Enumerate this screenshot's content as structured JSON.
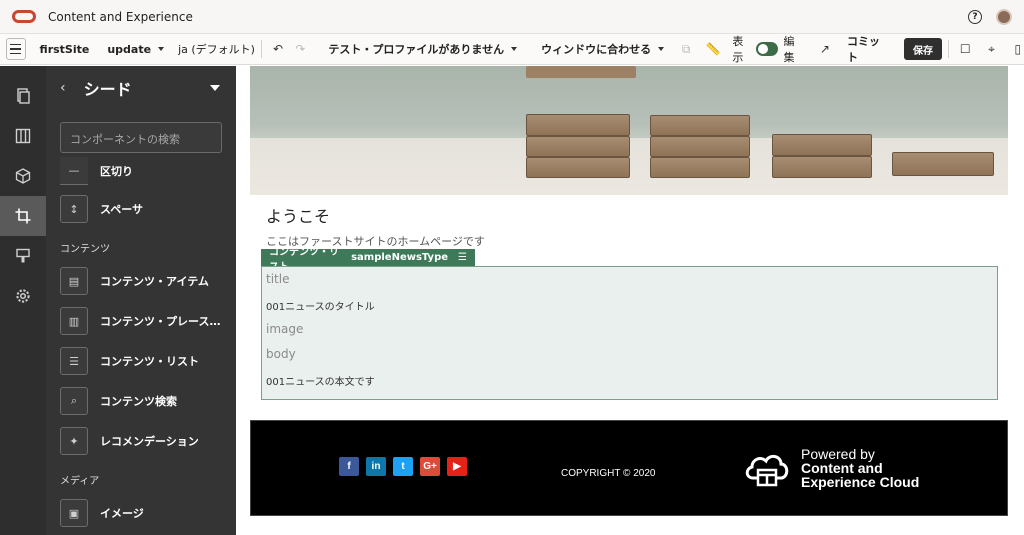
{
  "app": {
    "title": "Content and Experience",
    "help_icon": "help-icon",
    "avatar_icon": "user-avatar-icon"
  },
  "toolbar": {
    "site": "firstSite",
    "update": "update",
    "language": "ja (デフォルト)",
    "device_profile": "テスト・プロファイルがありません",
    "fit_window": "ウィンドウに合わせる",
    "view_label": "表示",
    "edit_label": "編集",
    "commit_label": "コミット",
    "save_label": "保存"
  },
  "panel": {
    "back": "‹",
    "title": "シード",
    "search_placeholder": "コンポーネントの検索",
    "items_top": [
      {
        "label": "区切り",
        "icon": "divider-icon"
      },
      {
        "label": "スペーサ",
        "icon": "spacer-icon"
      }
    ],
    "content_section": "コンテンツ",
    "content_items": [
      {
        "label": "コンテンツ・アイテム",
        "icon": "content-item-icon"
      },
      {
        "label": "コンテンツ・プレースホルダ",
        "icon": "content-placeholder-icon"
      },
      {
        "label": "コンテンツ・リスト",
        "icon": "content-list-icon"
      },
      {
        "label": "コンテンツ検索",
        "icon": "content-search-icon"
      },
      {
        "label": "レコメンデーション",
        "icon": "recommendation-icon"
      }
    ],
    "media_section": "メディア",
    "media_items": [
      {
        "label": "イメージ",
        "icon": "image-icon"
      }
    ]
  },
  "page": {
    "welcome": "ようこそ",
    "intro": "ここはファーストサイトのホームページです",
    "content_list_tag": "コンテンツ・リスト",
    "content_list_type": "sampleNewsType",
    "fields": {
      "title_label": "title",
      "title_value": "001ニュースのタイトル",
      "image_label": "image",
      "body_label": "body",
      "body_value": "001ニュースの本文です"
    }
  },
  "footer": {
    "copyright": "COPYRIGHT © 2020",
    "powered_by": "Powered by",
    "brand_line1": "Content and",
    "brand_line2": "Experience Cloud",
    "social": [
      "f",
      "in",
      "t",
      "G+",
      "▶"
    ]
  },
  "colors": {
    "accent": "#c74634",
    "save_bg": "#2f2f2f",
    "content_list_green": "#3e7a5a",
    "rail_bg": "#2e2e2e"
  }
}
